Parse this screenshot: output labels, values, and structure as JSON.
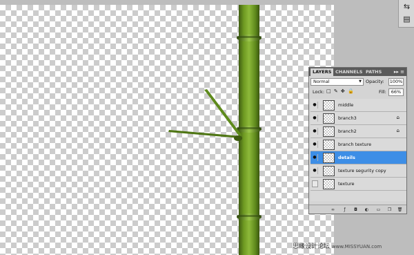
{
  "layers_panel": {
    "tabs": [
      "LAYERS",
      "CHANNELS",
      "PATHS"
    ],
    "menu_glyph": "▸▸ ≡",
    "blend_mode": "Normal",
    "opacity_label": "Opacity:",
    "opacity_value": "100%",
    "lock_label": "Lock:",
    "lock_icons": "□ ✎ ✥ 🔒",
    "fill_label": "Fill:",
    "fill_value": "66%",
    "layers": [
      {
        "name": "middle",
        "visible": true,
        "locked": false,
        "selected": false
      },
      {
        "name": "branch3",
        "visible": true,
        "locked": true,
        "selected": false
      },
      {
        "name": "branch2",
        "visible": true,
        "locked": true,
        "selected": false
      },
      {
        "name": "branch texture",
        "visible": true,
        "locked": false,
        "selected": false
      },
      {
        "name": "details",
        "visible": true,
        "locked": false,
        "selected": true
      },
      {
        "name": "texture segurity copy",
        "visible": true,
        "locked": false,
        "selected": false
      },
      {
        "name": "texture",
        "visible": false,
        "locked": false,
        "selected": false
      }
    ],
    "footer_icons": [
      "link-layers-icon",
      "fx-icon",
      "mask-icon",
      "adjustment-icon",
      "group-icon",
      "new-layer-icon",
      "trash-icon"
    ]
  },
  "watermark": {
    "text": "思缘设计论坛",
    "url": "www.MISSYUAN.com"
  },
  "colors": {
    "selection": "#3d8ee6",
    "bamboo": "#6f9a22"
  }
}
